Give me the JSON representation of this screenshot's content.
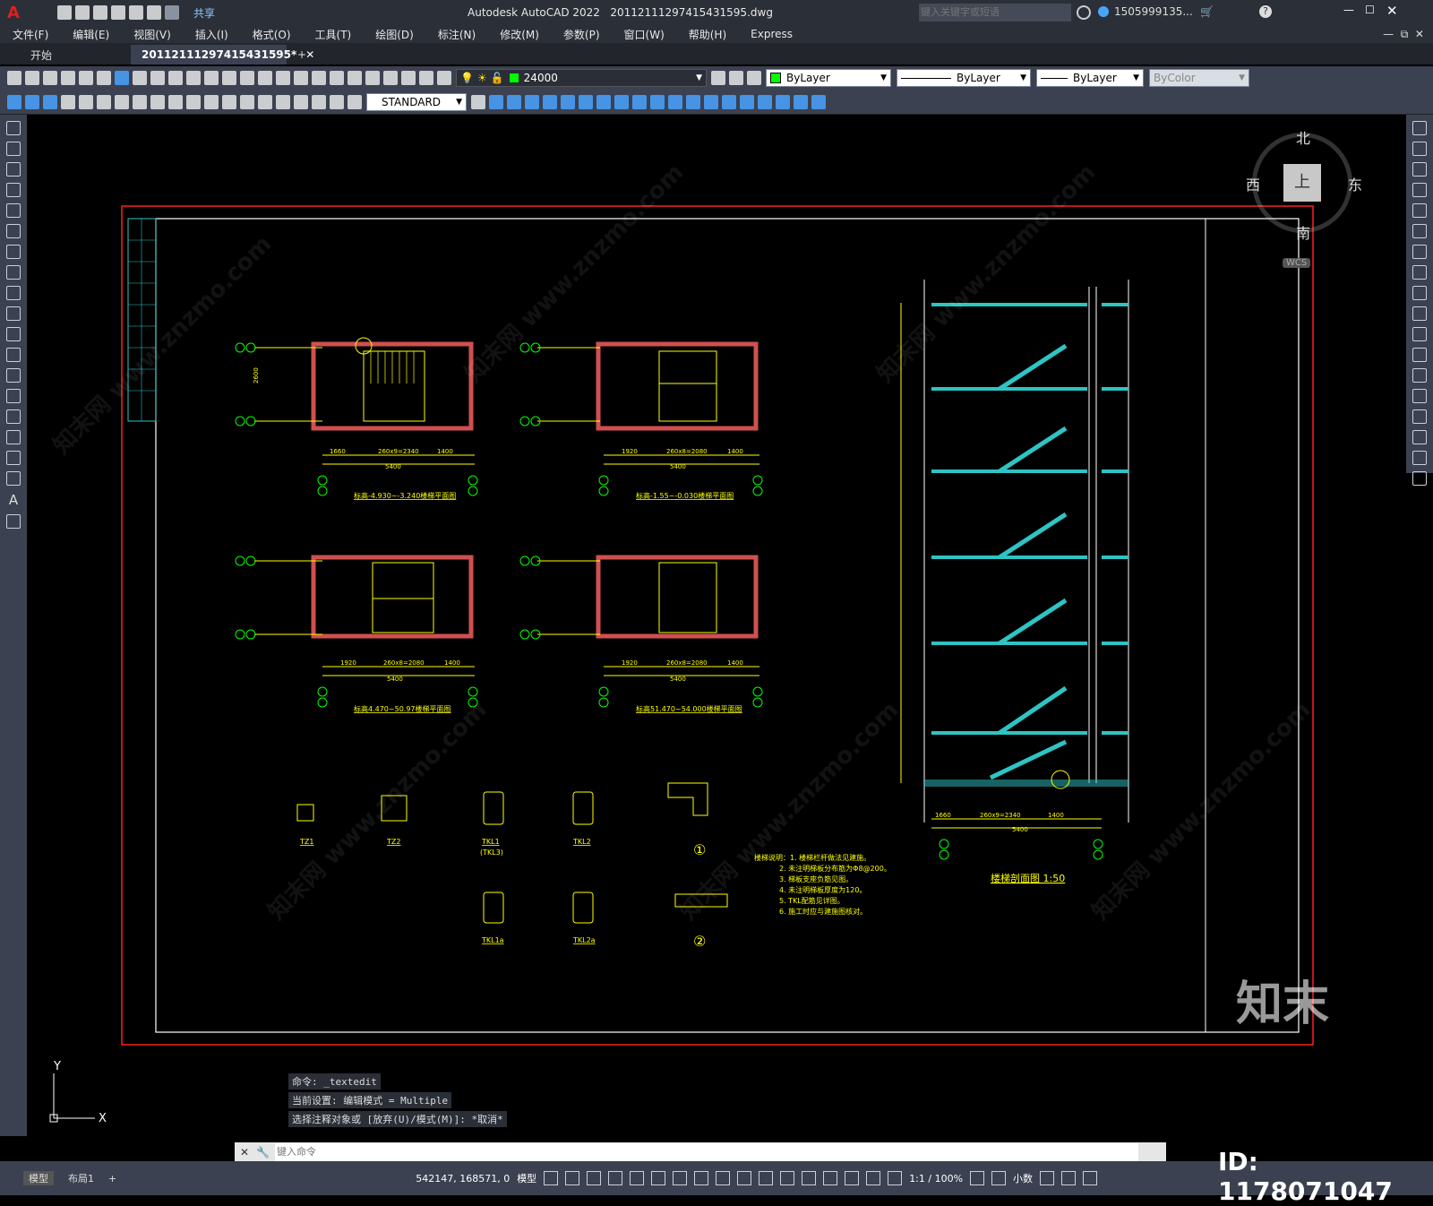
{
  "app": {
    "title": "Autodesk AutoCAD 2022",
    "filename": "20112111297415431595.dwg",
    "share_label": "共享"
  },
  "search": {
    "placeholder": "键入关键字或短语"
  },
  "user": {
    "name": "1505999135..."
  },
  "menu": {
    "items": [
      "文件(F)",
      "编辑(E)",
      "视图(V)",
      "插入(I)",
      "格式(O)",
      "工具(T)",
      "绘图(D)",
      "标注(N)",
      "修改(M)",
      "参数(P)",
      "窗口(W)",
      "帮助(H)",
      "Express"
    ]
  },
  "tabs": {
    "start": "开始",
    "doc": "20112111297415431595*"
  },
  "toolbar": {
    "layer": "24000",
    "color": "ByLayer",
    "linetype": "ByLayer",
    "lineweight": "ByLayer",
    "plotstyle": "ByColor",
    "textstyle": "STANDARD"
  },
  "viewcube": {
    "north": "北",
    "south": "南",
    "east": "东",
    "west": "西",
    "top": "上",
    "wcs": "WCS"
  },
  "drawing": {
    "plan1_title": "标高-4.930~-3.240楼梯平面图",
    "plan2_title": "标高-1.55~-0.030楼梯平面图",
    "plan3_title": "标高4.470~50.97楼梯平面图",
    "plan4_title": "标高51.470~54.000楼梯平面图",
    "dim_total": "5400",
    "dim_a": "1920",
    "dim_b": "260x8=2080",
    "dim_c": "1400",
    "dim_d": "1660",
    "dim_e": "260x9=2340",
    "dim_side": "2600",
    "section_title": "楼梯剖面图 1:50",
    "detail1": "①",
    "detail2": "②",
    "col_tz1": "TZ1",
    "col_tz2": "TZ2",
    "col_tkl1": "TKL1",
    "col_tkl3": "(TKL3)",
    "col_tkl2": "TKL2",
    "col_tkl1a": "TKL1a",
    "col_tkl2a": "TKL2a",
    "notes_title": "楼梯说明：1. 楼梯栏杆做法见建施。",
    "notes": [
      "2. 未注明梯板分布筋为Φ8@200。",
      "3. 梯板支座负筋见图。",
      "4. 未注明梯板厚度为120。",
      "5. TKL配筋见详图。",
      "6. 施工时应与建施图核对。"
    ]
  },
  "watermark": {
    "text": "知末网 www.znzmo.com",
    "brand": "知末",
    "id": "ID: 1178071047"
  },
  "command": {
    "history": [
      "命令: _textedit",
      "当前设置: 编辑模式 = Multiple",
      "选择注释对象或 [放弃(U)/模式(M)]: *取消*"
    ],
    "placeholder": "键入命令"
  },
  "layout_tabs": {
    "model": "模型",
    "layout1": "布局1",
    "add": "+"
  },
  "status": {
    "coords": "542147, 168571, 0",
    "space": "模型",
    "scale": "1:1 / 100%",
    "units": "小数"
  },
  "colors": {
    "cyan": "#2ec4c4",
    "yellow": "#ffff00",
    "green": "#00ff00",
    "red": "#ff3030",
    "brick": "#d05050"
  }
}
